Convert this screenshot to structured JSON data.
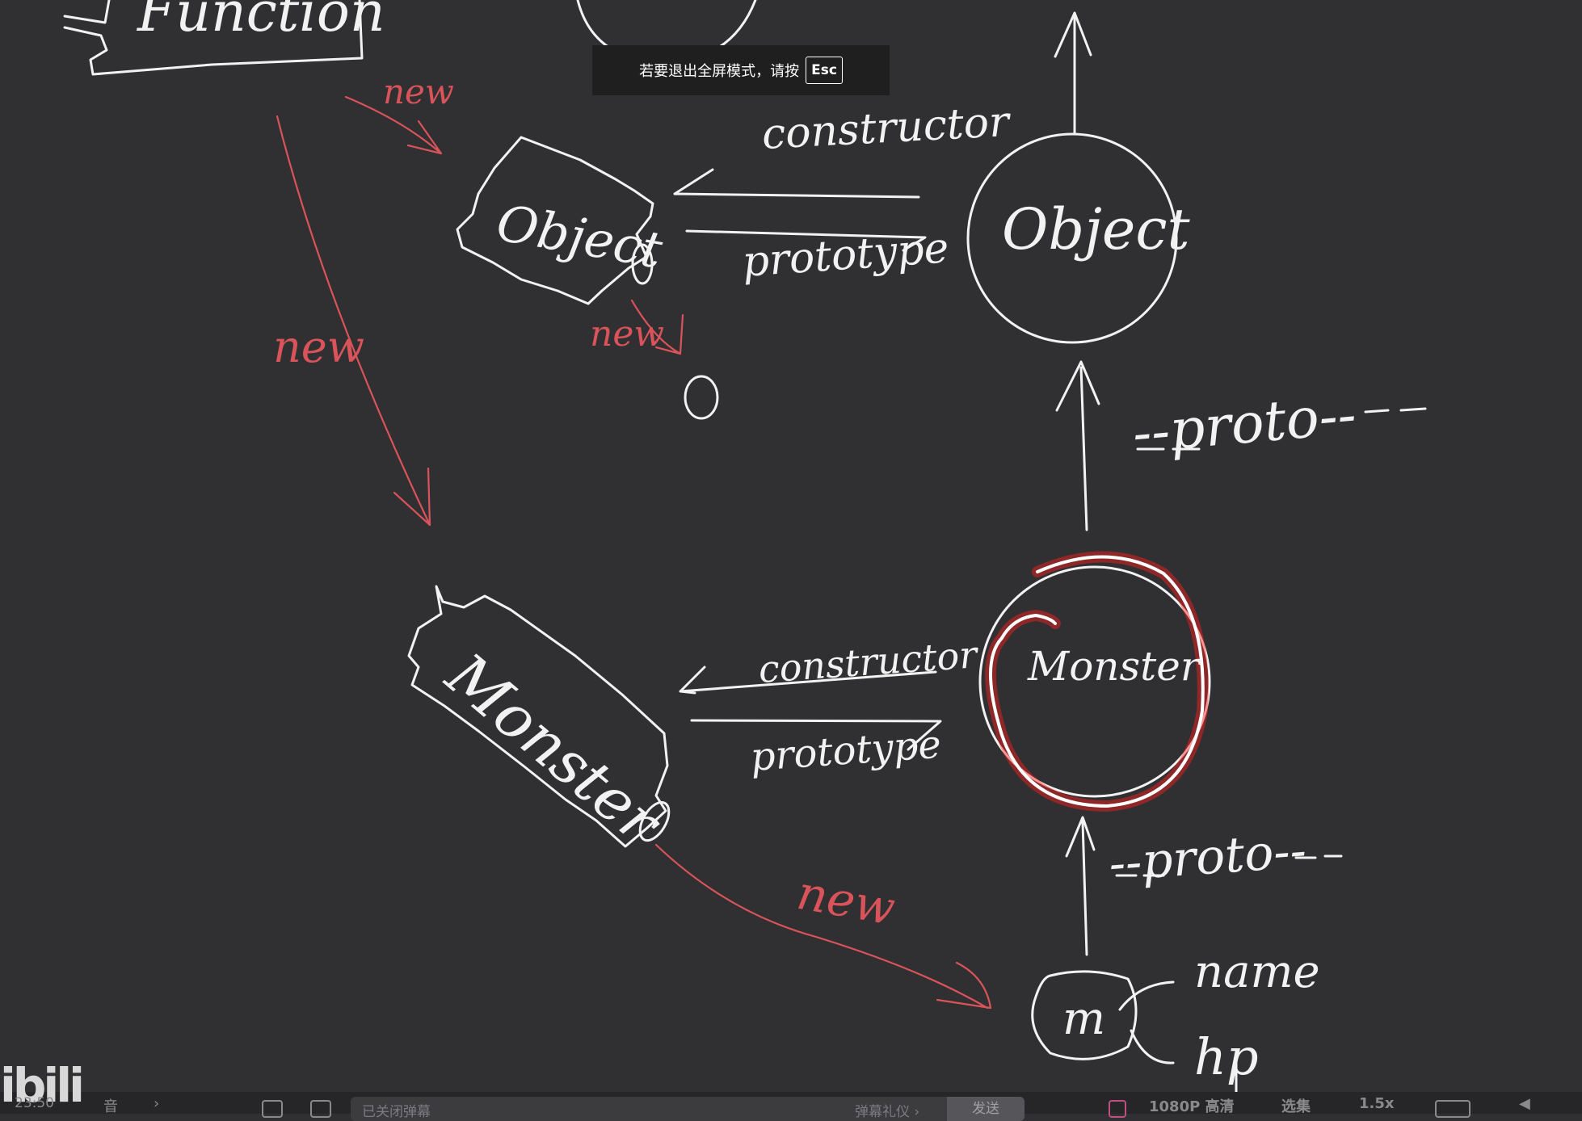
{
  "toast": {
    "message": "若要退出全屏模式，请按",
    "key": "Esc"
  },
  "board": {
    "labels": {
      "function_text": "Function",
      "new_1": "new",
      "new_2": "new",
      "new_3": "new",
      "new_4": "new",
      "object_fn": "Object",
      "object_proto": "Object",
      "constructor_top": "constructor",
      "prototype_top": "prototype",
      "zero": "0",
      "proto_top": "--proto--",
      "monster_fn": "Monster",
      "monster_proto": "Monster",
      "constructor_bottom": "constructor",
      "prototype_bottom": "prototype",
      "proto_bottom": "--proto--",
      "m": "m",
      "name": "name",
      "hp": "hp"
    },
    "colors": {
      "chalk": "#f2f2f2",
      "red_chalk": "#d9545a",
      "highlight": "#ff1010"
    }
  },
  "bottom_bar": {
    "logo": "ibili",
    "time": "23:50",
    "item_2": "音",
    "danmaku_placeholder": "已关闭弹幕",
    "danmaku_settings": "弹幕礼仪 ›",
    "send": "发送",
    "quality": "1080P 高清",
    "episodes": "选集",
    "speed": "1.5x"
  }
}
